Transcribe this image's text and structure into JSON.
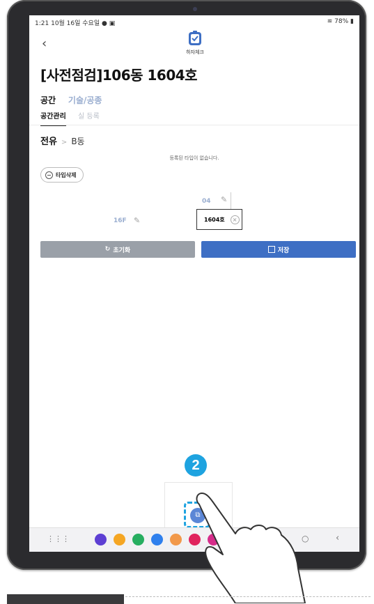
{
  "status": {
    "time": "1:21",
    "date": "10월 16일 수요일",
    "battery": "78%"
  },
  "app": {
    "name": "하자체크",
    "brand_color": "#3e6fc4"
  },
  "header": {
    "back_icon": "chevron-left-icon",
    "title": "[사전점검]106동 1604호"
  },
  "tabs_main": [
    {
      "label": "공간",
      "active": true
    },
    {
      "label": "기술/공종",
      "active": false
    }
  ],
  "tabs_sub": [
    {
      "label": "공간관리",
      "active": true
    },
    {
      "label": "실 등록",
      "active": false
    }
  ],
  "breadcrumb": {
    "root": "전유",
    "sep": ">",
    "leaf": "B동"
  },
  "empty_message": "등록된 타입이 없습니다.",
  "type_delete_label": "타입삭제",
  "grid": {
    "unit_label": "04",
    "floor_label": "16F",
    "room_label": "1604호"
  },
  "buttons": {
    "reset_label": "초기화",
    "save_label": "저장"
  },
  "tutorial": {
    "step_number": "2",
    "accent_color": "#1ea3e0"
  },
  "dock_icons": [
    {
      "name": "internet-icon",
      "color": "#5d3fd3"
    },
    {
      "name": "folder-icon",
      "color": "#f5a623"
    },
    {
      "name": "phone-icon",
      "color": "#27ae60"
    },
    {
      "name": "messages-icon",
      "color": "#2f80ed"
    },
    {
      "name": "contacts-icon",
      "color": "#f2994a"
    },
    {
      "name": "camera-icon",
      "color": "#e0245e"
    },
    {
      "name": "gallery-icon",
      "color": "#d62d8b"
    }
  ]
}
